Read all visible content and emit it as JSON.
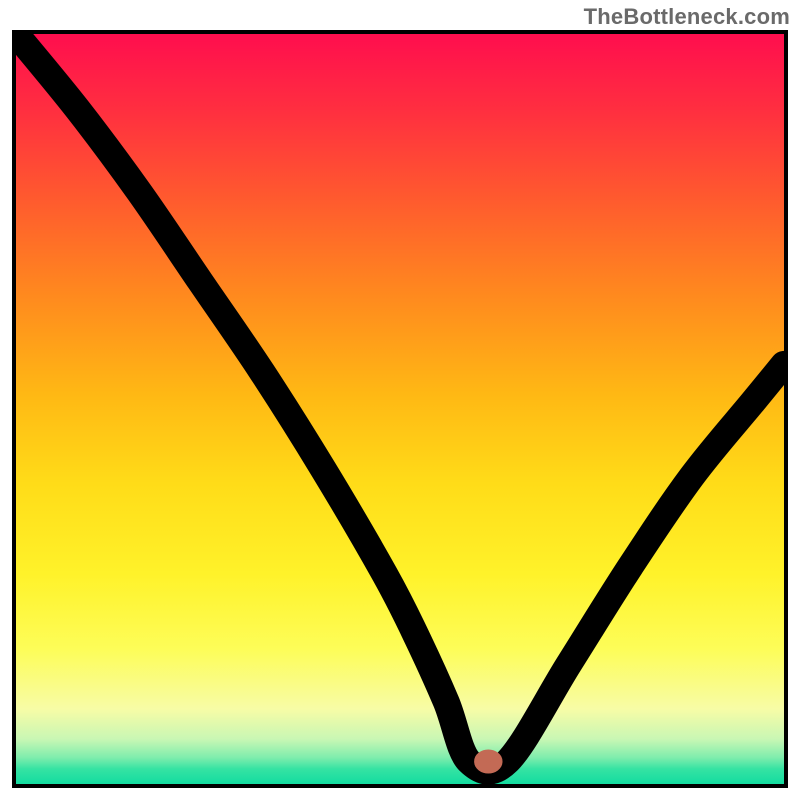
{
  "watermark": "TheBottleneck.com",
  "chart_data": {
    "type": "line",
    "title": "",
    "xlabel": "",
    "ylabel": "",
    "xlim": [
      0,
      100
    ],
    "ylim": [
      0,
      100
    ],
    "grid": false,
    "legend": false,
    "series": [
      {
        "name": "bottleneck-curve",
        "x": [
          0,
          8,
          16,
          24,
          32,
          40,
          48,
          52,
          56,
          59,
          64,
          72,
          80,
          88,
          96,
          100
        ],
        "values": [
          100,
          90,
          79,
          67,
          55,
          42,
          28,
          20,
          11,
          3,
          3,
          16,
          29,
          41,
          51,
          56
        ]
      }
    ],
    "marker": {
      "name": "optimal-point",
      "x": 61.5,
      "y": 3
    },
    "background_gradient_stops": [
      {
        "pos": 0.0,
        "color": "#ff0e4e"
      },
      {
        "pos": 0.1,
        "color": "#ff2e40"
      },
      {
        "pos": 0.22,
        "color": "#ff5a2e"
      },
      {
        "pos": 0.35,
        "color": "#ff8a1e"
      },
      {
        "pos": 0.48,
        "color": "#ffb814"
      },
      {
        "pos": 0.6,
        "color": "#ffdc18"
      },
      {
        "pos": 0.72,
        "color": "#fff22a"
      },
      {
        "pos": 0.82,
        "color": "#fdfd58"
      },
      {
        "pos": 0.9,
        "color": "#f7fca6"
      },
      {
        "pos": 0.94,
        "color": "#c9f7b4"
      },
      {
        "pos": 0.965,
        "color": "#7eedad"
      },
      {
        "pos": 0.98,
        "color": "#35e3a3"
      },
      {
        "pos": 1.0,
        "color": "#13dca0"
      }
    ]
  }
}
